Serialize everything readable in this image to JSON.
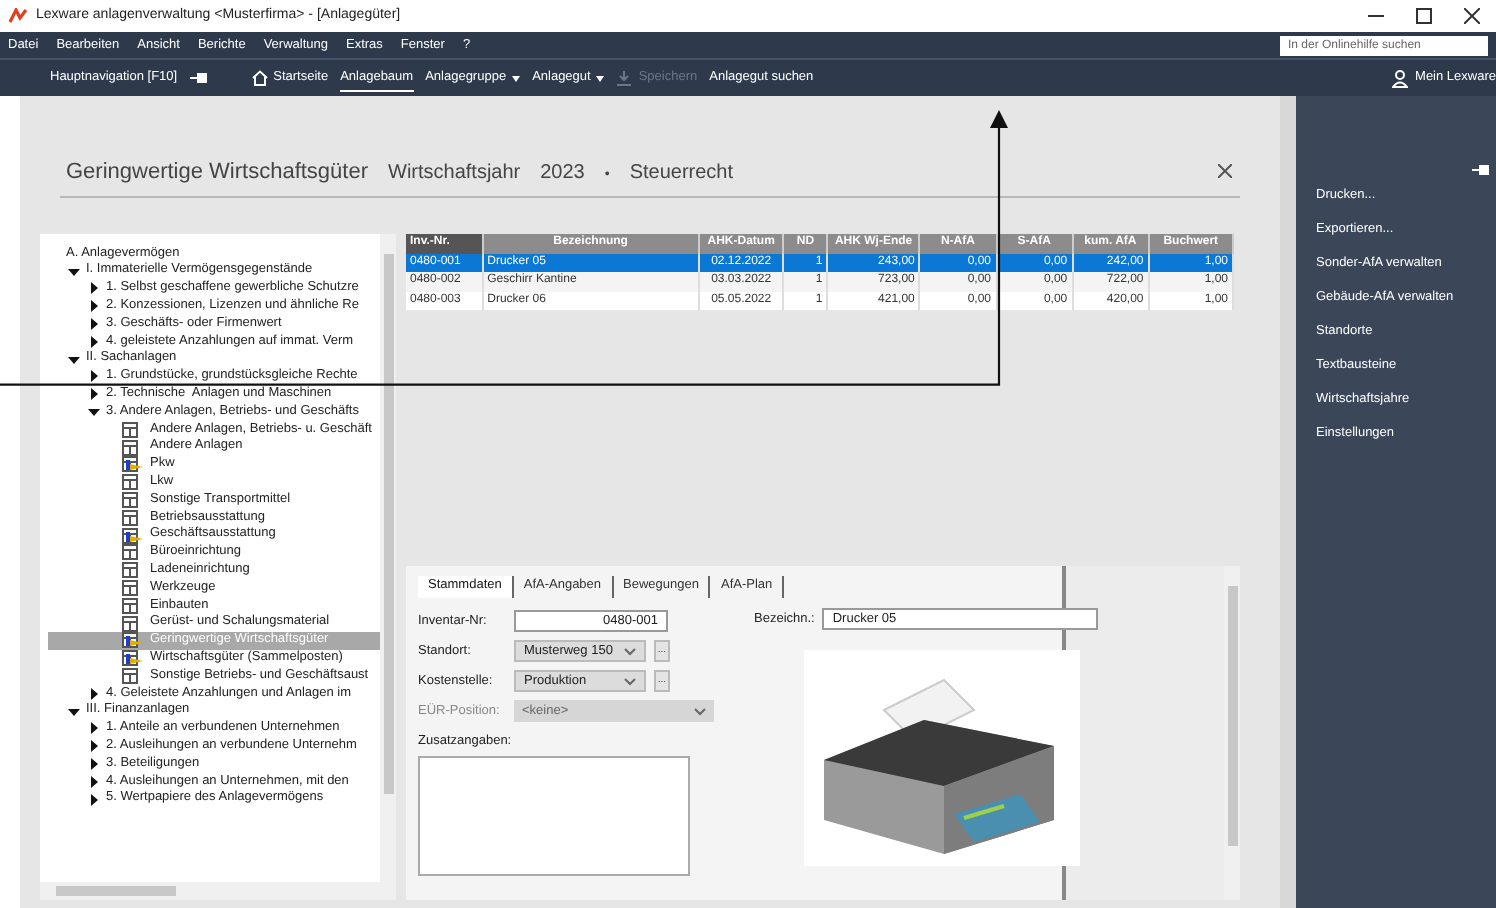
{
  "window": {
    "title": "Lexware anlagenverwaltung <Musterfirma> - [Anlagegüter]"
  },
  "menu": [
    "Datei",
    "Bearbeiten",
    "Ansicht",
    "Berichte",
    "Verwaltung",
    "Extras",
    "Fenster",
    "?"
  ],
  "help_search": {
    "placeholder": "In der Onlinehilfe suchen"
  },
  "toolbar": {
    "main_nav": "Hauptnavigation [F10]",
    "items": [
      {
        "label": "Startseite",
        "kind": "home",
        "selected": false,
        "disabled": false
      },
      {
        "label": "Anlagebaum",
        "kind": "plain",
        "selected": true,
        "disabled": false
      },
      {
        "label": "Anlagegruppe",
        "kind": "dropdown",
        "selected": false,
        "disabled": false
      },
      {
        "label": "Anlagegut",
        "kind": "dropdown",
        "selected": false,
        "disabled": false
      },
      {
        "label": "Speichern",
        "kind": "save",
        "selected": false,
        "disabled": true
      },
      {
        "label": "Anlagegut suchen",
        "kind": "plain",
        "selected": false,
        "disabled": false
      }
    ],
    "account": "Mein Lexware"
  },
  "heading": {
    "title": "Geringwertige Wirtschaftsgüter",
    "year_label": "Wirtschaftsjahr",
    "year": "2023",
    "separator": "•",
    "mode": "Steuerrecht"
  },
  "tree": [
    {
      "label": "A. Anlagevermögen",
      "kind": "heading",
      "selected": false,
      "children": [
        {
          "label": "I. Immaterielle Vermögensgegenstände",
          "kind": "group",
          "expanded": true,
          "selected": false,
          "children": [
            {
              "label": "1. Selbst geschaffene gewerbliche Schutzre",
              "kind": "group",
              "expanded": false,
              "selected": false
            },
            {
              "label": "2. Konzessionen, Lizenzen und ähnliche Re",
              "kind": "group",
              "expanded": false,
              "selected": false
            },
            {
              "label": "3. Geschäfts- oder Firmenwert",
              "kind": "group",
              "expanded": false,
              "selected": false
            },
            {
              "label": "4. geleistete Anzahlungen auf immat. Verm",
              "kind": "group",
              "expanded": false,
              "selected": false
            }
          ]
        },
        {
          "label": "II. Sachanlagen",
          "kind": "group",
          "expanded": true,
          "selected": false,
          "children": [
            {
              "label": "1. Grundstücke, grundstücksgleiche Rechte",
              "kind": "group",
              "expanded": false,
              "selected": false
            },
            {
              "label": "2. Technische  Anlagen und Maschinen",
              "kind": "group",
              "expanded": false,
              "selected": false
            },
            {
              "label": "3. Andere Anlagen, Betriebs- und Geschäfts",
              "kind": "group",
              "expanded": true,
              "selected": false,
              "children": [
                {
                  "label": "Andere Anlagen, Betriebs- u. Geschäft",
                  "kind": "table",
                  "selected": false
                },
                {
                  "label": "Andere Anlagen",
                  "kind": "table",
                  "selected": false
                },
                {
                  "label": "Pkw",
                  "kind": "linked",
                  "selected": false
                },
                {
                  "label": "Lkw",
                  "kind": "table",
                  "selected": false
                },
                {
                  "label": "Sonstige Transportmittel",
                  "kind": "table",
                  "selected": false
                },
                {
                  "label": "Betriebsausstattung",
                  "kind": "table",
                  "selected": false
                },
                {
                  "label": "Geschäftsausstattung",
                  "kind": "linked",
                  "selected": false
                },
                {
                  "label": "Büroeinrichtung",
                  "kind": "table",
                  "selected": false
                },
                {
                  "label": "Ladeneinrichtung",
                  "kind": "table",
                  "selected": false
                },
                {
                  "label": "Werkzeuge",
                  "kind": "table",
                  "selected": false
                },
                {
                  "label": "Einbauten",
                  "kind": "table",
                  "selected": false
                },
                {
                  "label": "Gerüst- und Schalungsmaterial",
                  "kind": "table",
                  "selected": false
                },
                {
                  "label": "Geringwertige Wirtschaftsgüter",
                  "kind": "linked",
                  "selected": true
                },
                {
                  "label": "Wirtschaftsgüter (Sammelposten)",
                  "kind": "linked",
                  "selected": false
                },
                {
                  "label": "Sonstige Betriebs- und Geschäftsaust",
                  "kind": "table",
                  "selected": false
                }
              ]
            },
            {
              "label": "4. Geleistete Anzahlungen und Anlagen im",
              "kind": "group",
              "expanded": false,
              "selected": false
            }
          ]
        },
        {
          "label": "III. Finanzanlagen",
          "kind": "group",
          "expanded": true,
          "selected": false,
          "children": [
            {
              "label": "1. Anteile an verbundenen Unternehmen",
              "kind": "group",
              "expanded": false,
              "selected": false
            },
            {
              "label": "2. Ausleihungen an verbundene Unternehm",
              "kind": "group",
              "expanded": false,
              "selected": false
            },
            {
              "label": "3. Beteiligungen",
              "kind": "group",
              "expanded": false,
              "selected": false
            },
            {
              "label": "4. Ausleihungen an Unternehmen, mit den",
              "kind": "group",
              "expanded": false,
              "selected": false
            },
            {
              "label": "5. Wertpapiere des Anlagevermögens",
              "kind": "group",
              "expanded": false,
              "selected": false
            }
          ]
        }
      ]
    }
  ],
  "table": {
    "columns": [
      "Inv.-Nr.",
      "Bezeichnung",
      "AHK-Datum",
      "ND",
      "AHK Wj-Ende",
      "N-AfA",
      "S-AfA",
      "kum. AfA",
      "Buchwert"
    ],
    "rows": [
      {
        "selected": true,
        "cells": [
          "0480-001",
          "Drucker 05",
          "02.12.2022",
          "1",
          "243,00",
          "0,00",
          "0,00",
          "242,00",
          "1,00"
        ]
      },
      {
        "selected": false,
        "cells": [
          "0480-002",
          "Geschirr Kantine",
          "03.03.2022",
          "1",
          "723,00",
          "0,00",
          "0,00",
          "722,00",
          "1,00"
        ]
      },
      {
        "selected": false,
        "cells": [
          "0480-003",
          "Drucker 06",
          "05.05.2022",
          "1",
          "421,00",
          "0,00",
          "0,00",
          "420,00",
          "1,00"
        ]
      }
    ]
  },
  "form": {
    "tabs": [
      {
        "label": "Stammdaten",
        "selected": true
      },
      {
        "label": "AfA-Angaben",
        "selected": false
      },
      {
        "label": "Bewegungen",
        "selected": false
      },
      {
        "label": "AfA-Plan",
        "selected": false
      }
    ],
    "inventory": {
      "label": "Inventar-Nr:",
      "value": "0480-001"
    },
    "name": {
      "label": "Bezeichn.:",
      "value": "Drucker 05"
    },
    "location": {
      "label": "Standort:",
      "value": "Musterweg 150",
      "disabled": false
    },
    "cost_center": {
      "label": "Kostenstelle:",
      "value": "Produktion",
      "disabled": false
    },
    "eur_position": {
      "label": "EÜR-Position:",
      "value": "<keine>",
      "disabled": true
    },
    "extra": {
      "label": "Zusatzangaben:"
    },
    "more_button": "..."
  },
  "sidebar": [
    "Drucken...",
    "Exportieren...",
    "Sonder-AfA verwalten",
    "Gebäude-AfA verwalten",
    "Standorte",
    "Textbausteine",
    "Wirtschaftsjahre",
    "Einstellungen"
  ]
}
